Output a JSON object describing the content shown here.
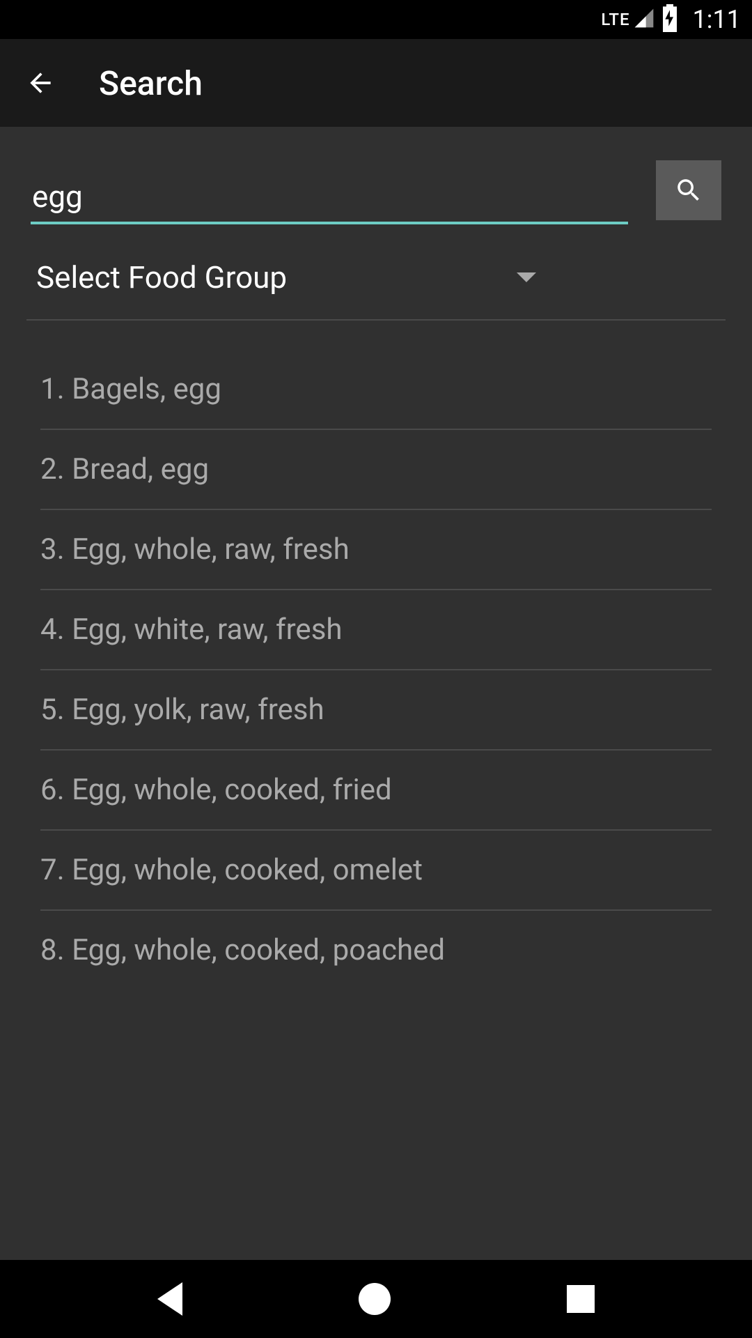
{
  "statusBar": {
    "network": "LTE",
    "time": "1:11"
  },
  "appBar": {
    "title": "Search"
  },
  "search": {
    "value": "egg"
  },
  "dropdown": {
    "label": "Select Food Group"
  },
  "results": [
    "1. Bagels, egg",
    "2. Bread, egg",
    "3. Egg, whole, raw, fresh",
    "4. Egg, white, raw, fresh",
    "5. Egg, yolk, raw, fresh",
    "6. Egg, whole, cooked, fried",
    "7. Egg, whole, cooked, omelet",
    "8. Egg, whole, cooked, poached"
  ]
}
